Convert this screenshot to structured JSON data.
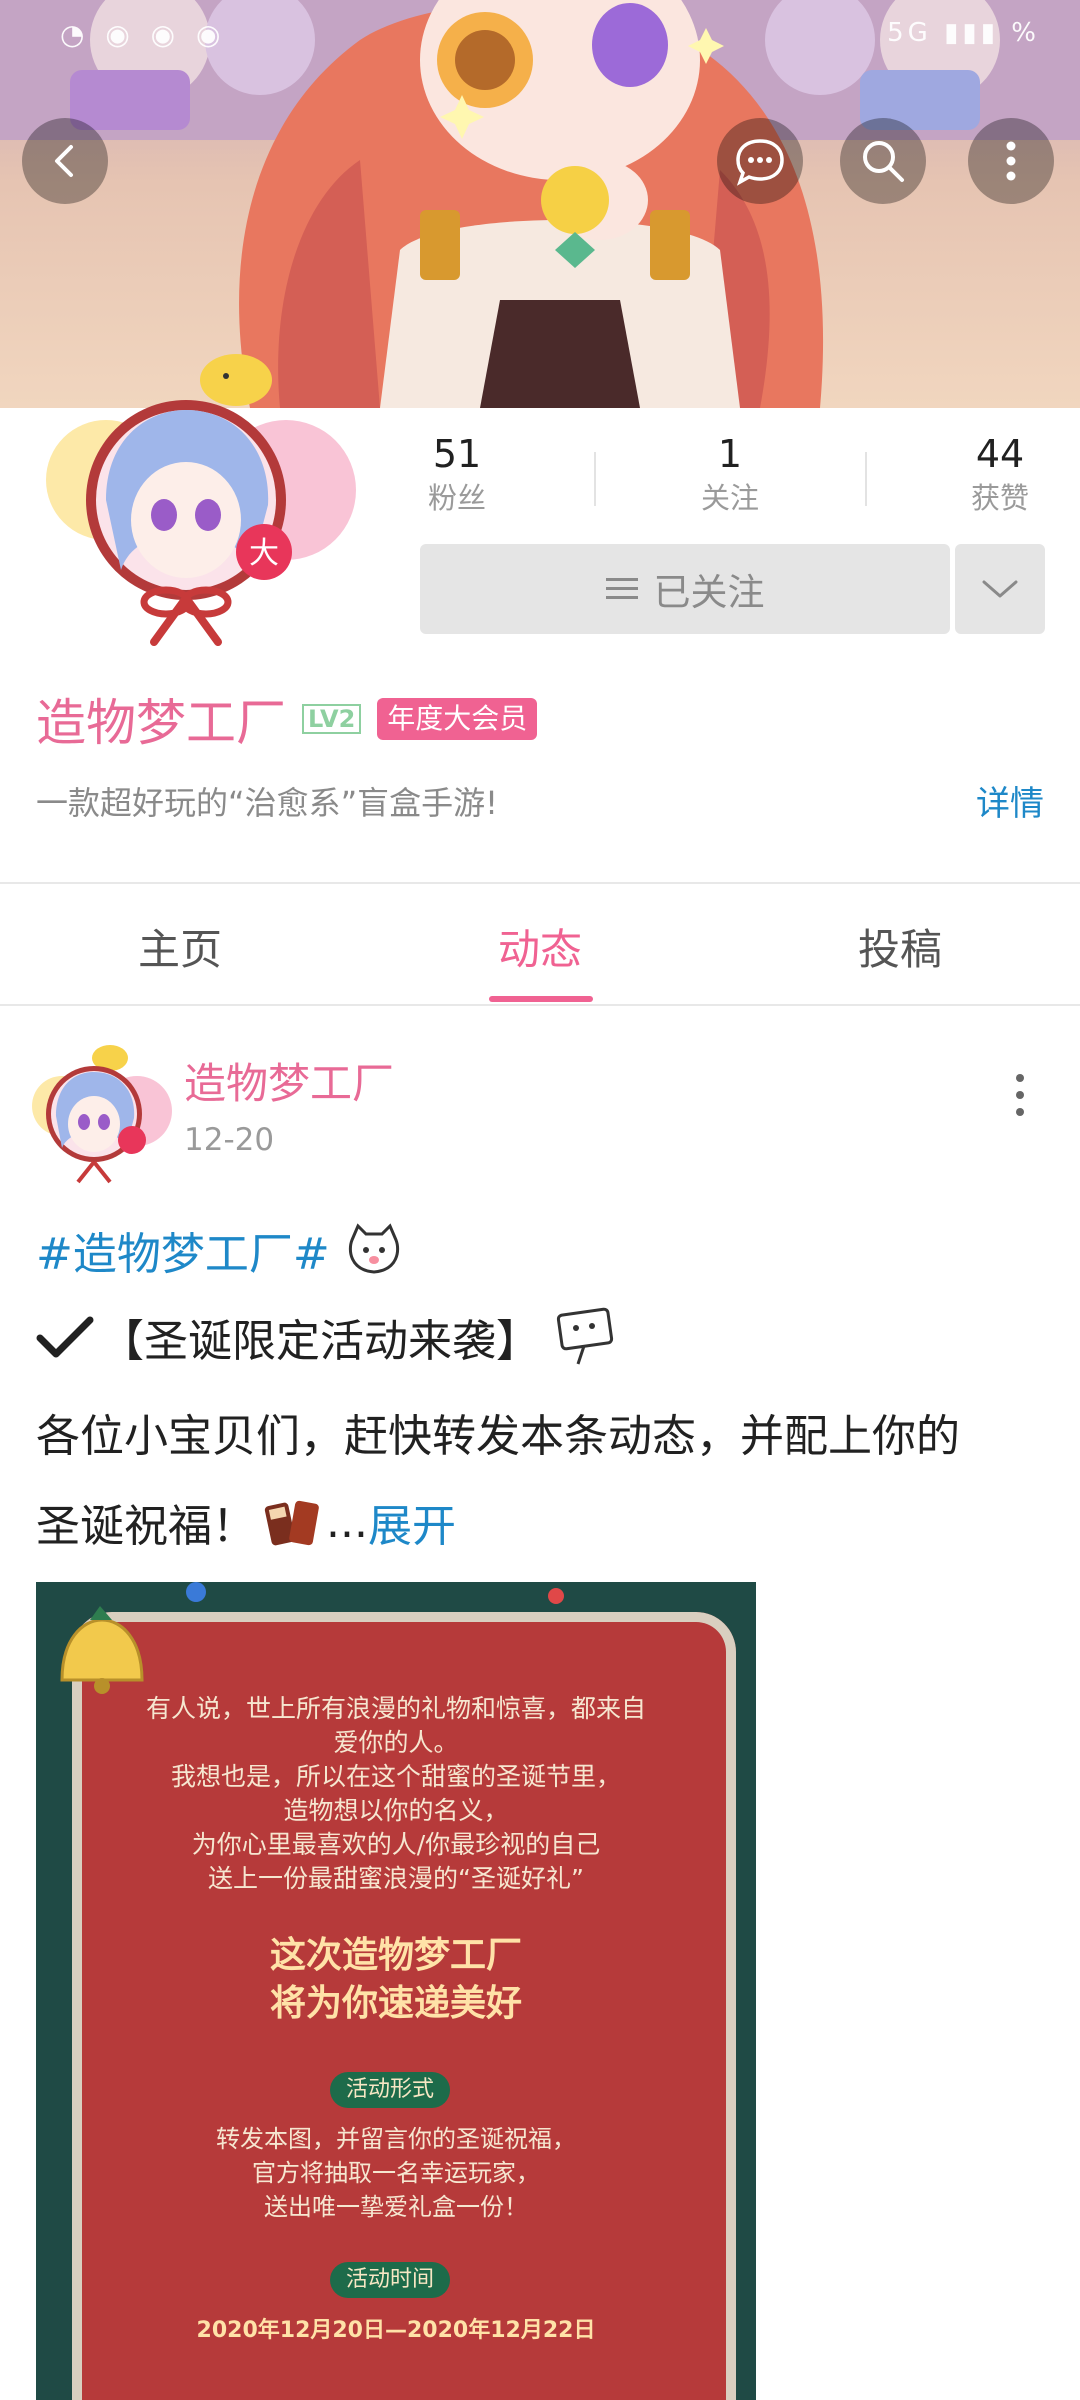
{
  "status_bar": {
    "left_icons": "◔ ◉ ◉ ◉",
    "right_text": "5G ▮▮▮ %"
  },
  "header": {
    "back_icon": "chevron-left-icon",
    "message_icon": "chat-bubble-icon",
    "search_icon": "search-icon",
    "more_icon": "more-vertical-icon"
  },
  "profile": {
    "avatar_badge": "大",
    "stats": [
      {
        "value": "51",
        "label": "粉丝"
      },
      {
        "value": "1",
        "label": "关注"
      },
      {
        "value": "44",
        "label": "获赞"
      }
    ],
    "follow_button_label": "已关注",
    "name": "造物梦工厂",
    "level_badge": "LV2",
    "vip_badge": "年度大会员",
    "bio": "一款超好玩的“治愈系”盲盒手游!",
    "detail_link": "详情"
  },
  "tabs": [
    {
      "label": "主页",
      "active": false
    },
    {
      "label": "动态",
      "active": true
    },
    {
      "label": "投稿",
      "active": false
    }
  ],
  "post": {
    "author": "造物梦工厂",
    "date": "12-20",
    "topic": "#造物梦工厂#",
    "line1": "【圣诞限定活动来袭】",
    "line2": "各位小宝贝们，赶快转发本条动态，并配上你的",
    "line3_text": "圣诞祝福！",
    "ellipsis": "...",
    "expand_label": "展开",
    "poster": {
      "intro_1": "有人说，世上所有浪漫的礼物和惊喜，都来自",
      "intro_2": "爱你的人。",
      "intro_3": "我想也是，所以在这个甜蜜的圣诞节里，",
      "intro_4": "造物想以你的名义，",
      "intro_5": "为你心里最喜欢的人/你最珍视的自己",
      "intro_6": "送上一份最甜蜜浪漫的“圣诞好礼”",
      "headline_1": "这次造物梦工厂",
      "headline_2": "将为你速递美好",
      "section1_title": "活动形式",
      "body_1": "转发本图，并留言你的圣诞祝福，",
      "body_2": "官方将抽取一名幸运玩家，",
      "body_3": "送出唯一挚爱礼盒一份！",
      "section2_title": "活动时间",
      "time": "2020年12月20日—2020年12月22日"
    }
  },
  "colors": {
    "accent_pink": "#f06292",
    "link_blue": "#1e88c8",
    "name_pink": "#e86a96"
  }
}
